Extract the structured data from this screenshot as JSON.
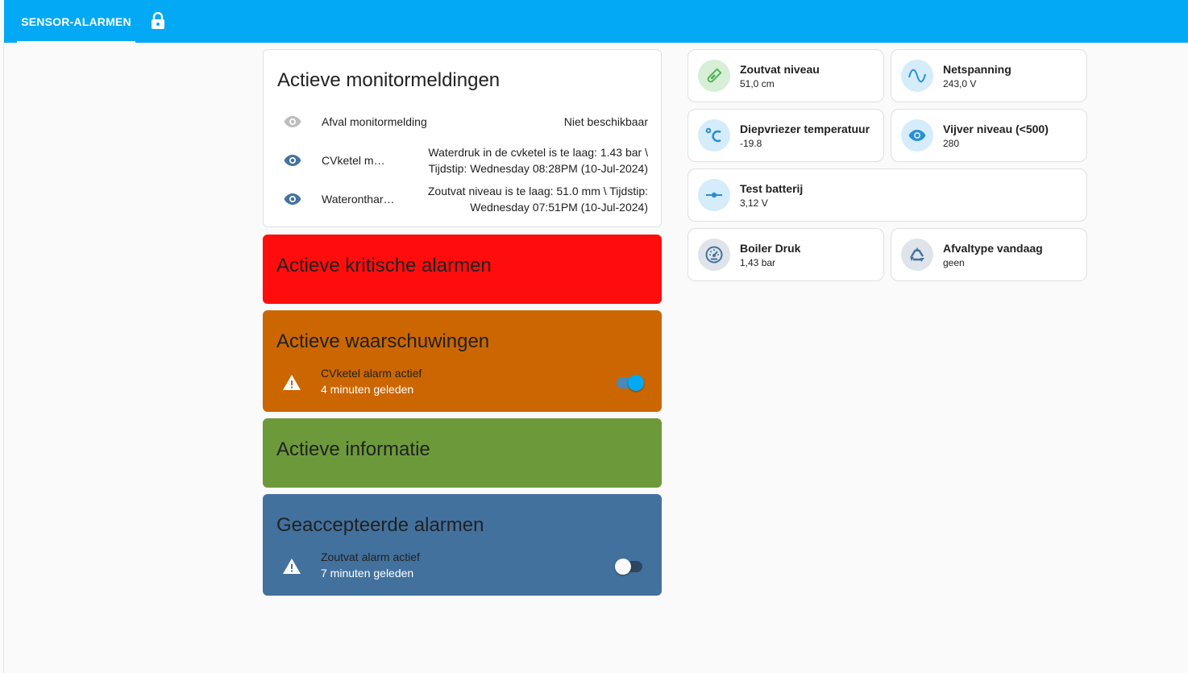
{
  "header": {
    "tab_label": "SENSOR-ALARMEN",
    "lock_icon": "lock-icon",
    "accent_color": "#03a9f4"
  },
  "monitor_card": {
    "title": "Actieve monitormeldingen",
    "rows": [
      {
        "name": "Afval monitormelding",
        "state": "Niet beschikbaar",
        "icon": "eye-icon",
        "active": false
      },
      {
        "name": "CVketel m…",
        "state_line1": "Waterdruk in de cvketel is te laag: 1.43 bar \\",
        "state_line2": "Tijdstip: Wednesday 08:28PM (10-Jul-2024)",
        "icon": "eye-icon",
        "active": true
      },
      {
        "name": "Wateronthar…",
        "state_line1": "Zoutvat niveau is te laag: 51.0 mm \\ Tijdstip:",
        "state_line2": "Wednesday 07:51PM (10-Jul-2024)",
        "icon": "eye-icon",
        "active": true
      }
    ]
  },
  "critical_card": {
    "title": "Actieve kritische alarmen",
    "color": "#ff0d0d"
  },
  "warnings_card": {
    "title": "Actieve waarschuwingen",
    "color": "#cc6600",
    "alarm": {
      "label": "CVketel alarm actief",
      "time": "4 minuten geleden",
      "icon": "alert-icon",
      "toggle_on": true
    }
  },
  "info_card": {
    "title": "Actieve informatie",
    "color": "#6c9a3a"
  },
  "accepted_card": {
    "title": "Geaccepteerde alarmen",
    "color": "#43719e",
    "alarm": {
      "label": "Zoutvat alarm actief",
      "time": "7 minuten geleden",
      "icon": "alert-icon",
      "toggle_on": false
    }
  },
  "tiles": [
    {
      "name": "Zoutvat niveau",
      "value": "51,0 cm",
      "icon": "test-tube-icon"
    },
    {
      "name": "Netspanning",
      "value": "243,0 V",
      "icon": "sine-wave-icon"
    },
    {
      "name": "Diepvriezer temperatuur",
      "value": "-19.8",
      "icon": "celsius-icon"
    },
    {
      "name": "Vijver niveau (<500)",
      "value": "280",
      "icon": "eye-icon"
    },
    {
      "name": "Test batterij",
      "value": "3,12 V",
      "icon": "slider-icon"
    },
    {
      "name": "Boiler Druk",
      "value": "1,43 bar",
      "icon": "gauge-icon"
    },
    {
      "name": "Afvaltype vandaag",
      "value": "geen",
      "icon": "recycle-icon"
    }
  ]
}
